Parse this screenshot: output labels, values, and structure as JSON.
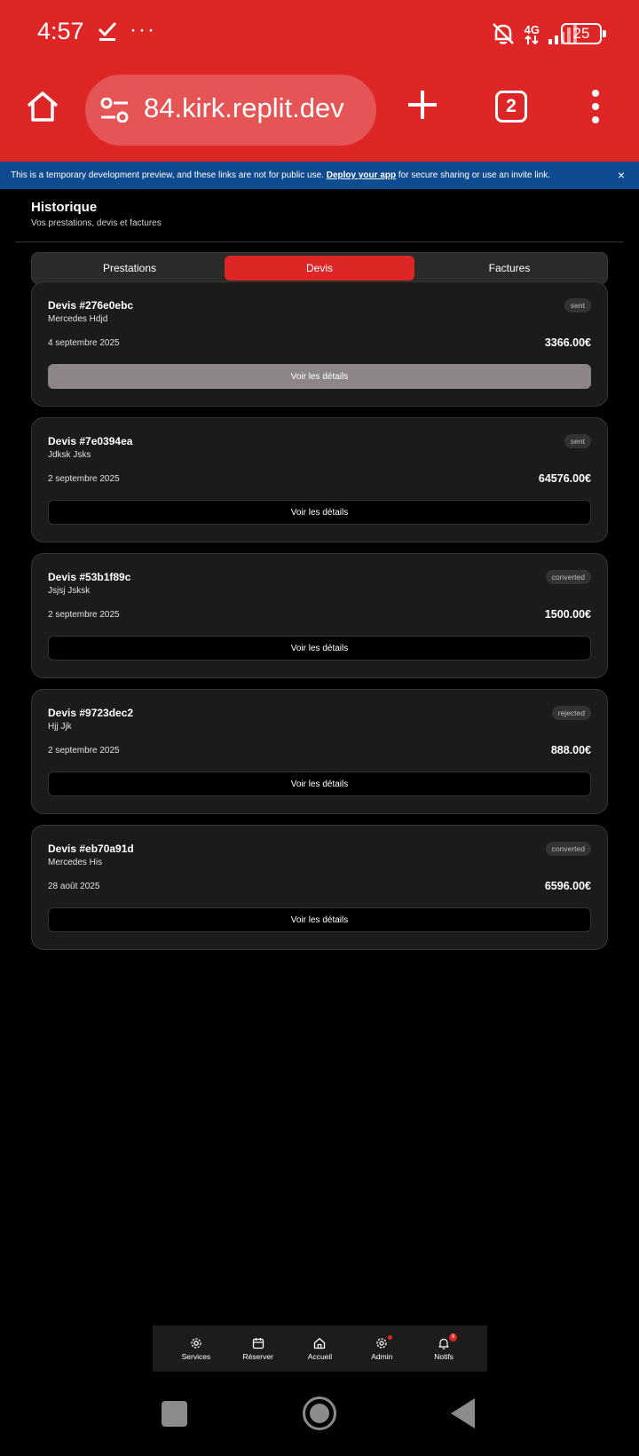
{
  "status_bar": {
    "time": "4:57",
    "network": "4G",
    "battery": "25"
  },
  "browser": {
    "url": "84.kirk.replit.dev",
    "tab_count": "2"
  },
  "banner": {
    "text_before": "This is a temporary development preview, and these links are not for public use.",
    "link": "Deploy your app",
    "text_after": "for secure sharing or use an invite link.",
    "close": "×"
  },
  "header": {
    "title": "Historique",
    "subtitle": "Vos prestations, devis et factures"
  },
  "tabs": [
    {
      "label": "Prestations",
      "active": false
    },
    {
      "label": "Devis",
      "active": true
    },
    {
      "label": "Factures",
      "active": false
    }
  ],
  "quotes": [
    {
      "title": "Devis #276e0ebc",
      "client": "Mercedes Hdjd",
      "status": "sent",
      "date": "4 septembre 2025",
      "amount": "3366.00€",
      "button": "Voir les détails"
    },
    {
      "title": "Devis #7e0394ea",
      "client": "Jdksk Jsks",
      "status": "sent",
      "date": "2 septembre 2025",
      "amount": "64576.00€",
      "button": "Voir les détails"
    },
    {
      "title": "Devis #53b1f89c",
      "client": "Jsjsj Jsksk",
      "status": "converted",
      "date": "2 septembre 2025",
      "amount": "1500.00€",
      "button": "Voir les détails"
    },
    {
      "title": "Devis #9723dec2",
      "client": "Hjj Jjk",
      "status": "rejected",
      "date": "2 septembre 2025",
      "amount": "888.00€",
      "button": "Voir les détails"
    },
    {
      "title": "Devis #eb70a91d",
      "client": "Mercedes His",
      "status": "converted",
      "date": "28 août 2025",
      "amount": "6596.00€",
      "button": "Voir les détails"
    }
  ],
  "bottom_nav": [
    {
      "label": "Services",
      "icon": "gear-icon"
    },
    {
      "label": "Réserver",
      "icon": "calendar-icon"
    },
    {
      "label": "Accueil",
      "icon": "home-icon"
    },
    {
      "label": "Admin",
      "icon": "settings-icon"
    },
    {
      "label": "Notifs",
      "icon": "bell-icon",
      "count": "9"
    }
  ],
  "colors": {
    "brand_red": "#df2627",
    "banner_blue": "#0f4c8f",
    "card_bg": "#1b1b1b"
  }
}
